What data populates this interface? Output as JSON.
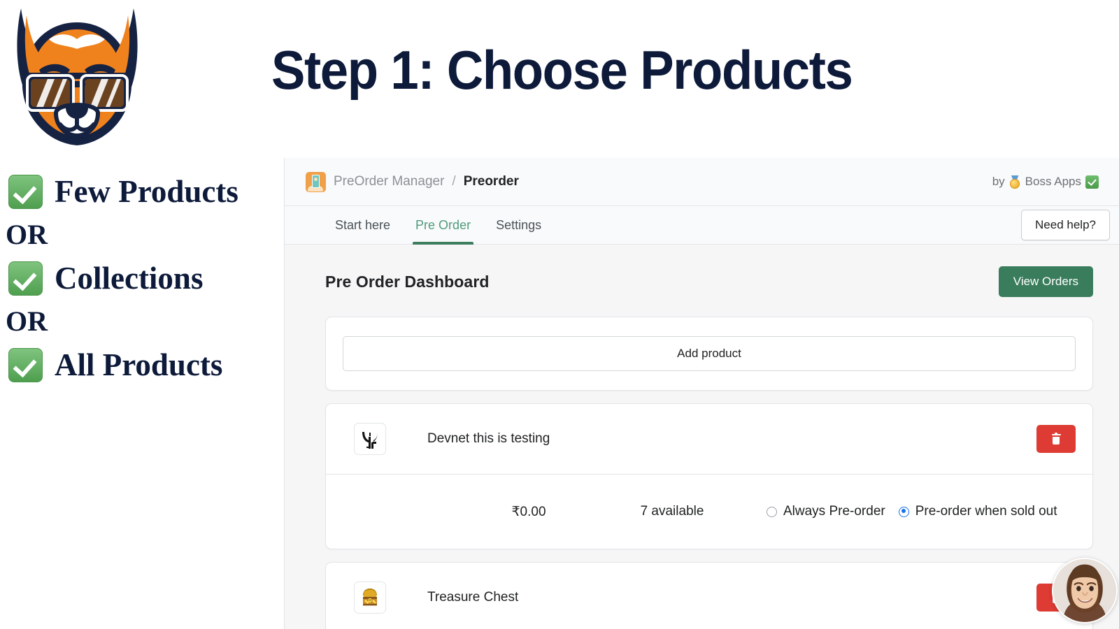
{
  "slide": {
    "title": "Step 1: Choose Products",
    "logo_icon": "fox-with-sunglasses-logo",
    "checklist": [
      {
        "icon": "green-check-icon",
        "label": "Few Products"
      },
      {
        "or": "OR"
      },
      {
        "icon": "green-check-icon",
        "label": "Collections"
      },
      {
        "or": "OR"
      },
      {
        "icon": "green-check-icon",
        "label": "All Products"
      }
    ],
    "or_text": "OR",
    "title_color": "#0d1a3a",
    "check_color": "#4f9f4f",
    "fox_orange": "#f0821e",
    "fox_navy": "#152242"
  },
  "app": {
    "breadcrumb": {
      "app_icon": "preorder-app-icon",
      "app_name": "PreOrder Manager",
      "separator": "/",
      "current": "Preorder"
    },
    "byline": {
      "prefix": "by",
      "medal_icon": "medal-icon",
      "vendor": "Boss Apps",
      "check_icon": "green-check-icon"
    },
    "tabs": [
      {
        "label": "Start here",
        "active": false
      },
      {
        "label": "Pre Order",
        "active": true
      },
      {
        "label": "Settings",
        "active": false
      }
    ],
    "help_button": "Need help?",
    "active_tab_color": "#3f7d5f"
  },
  "dashboard": {
    "title": "Pre Order Dashboard",
    "view_orders_button": "View Orders",
    "view_orders_color": "#3a7d5c",
    "add_product_button": "Add product",
    "products": [
      {
        "thumb_icon": "bull-horns-logo",
        "name": "Devnet this is testing",
        "delete_icon": "trash-icon",
        "price": "₹0.00",
        "availability": "7 available",
        "options": [
          {
            "label": "Always Pre-order",
            "selected": false
          },
          {
            "label": "Pre-order when sold out",
            "selected": true
          }
        ]
      },
      {
        "thumb_icon": "treasure-chest-icon",
        "name": "Treasure Chest",
        "delete_icon": "trash-icon"
      }
    ],
    "selected_radio_color": "#1a73e8",
    "delete_button_color": "#dd3b33"
  },
  "overlay": {
    "webcam_avatar": "presenter-webcam-bubble"
  }
}
